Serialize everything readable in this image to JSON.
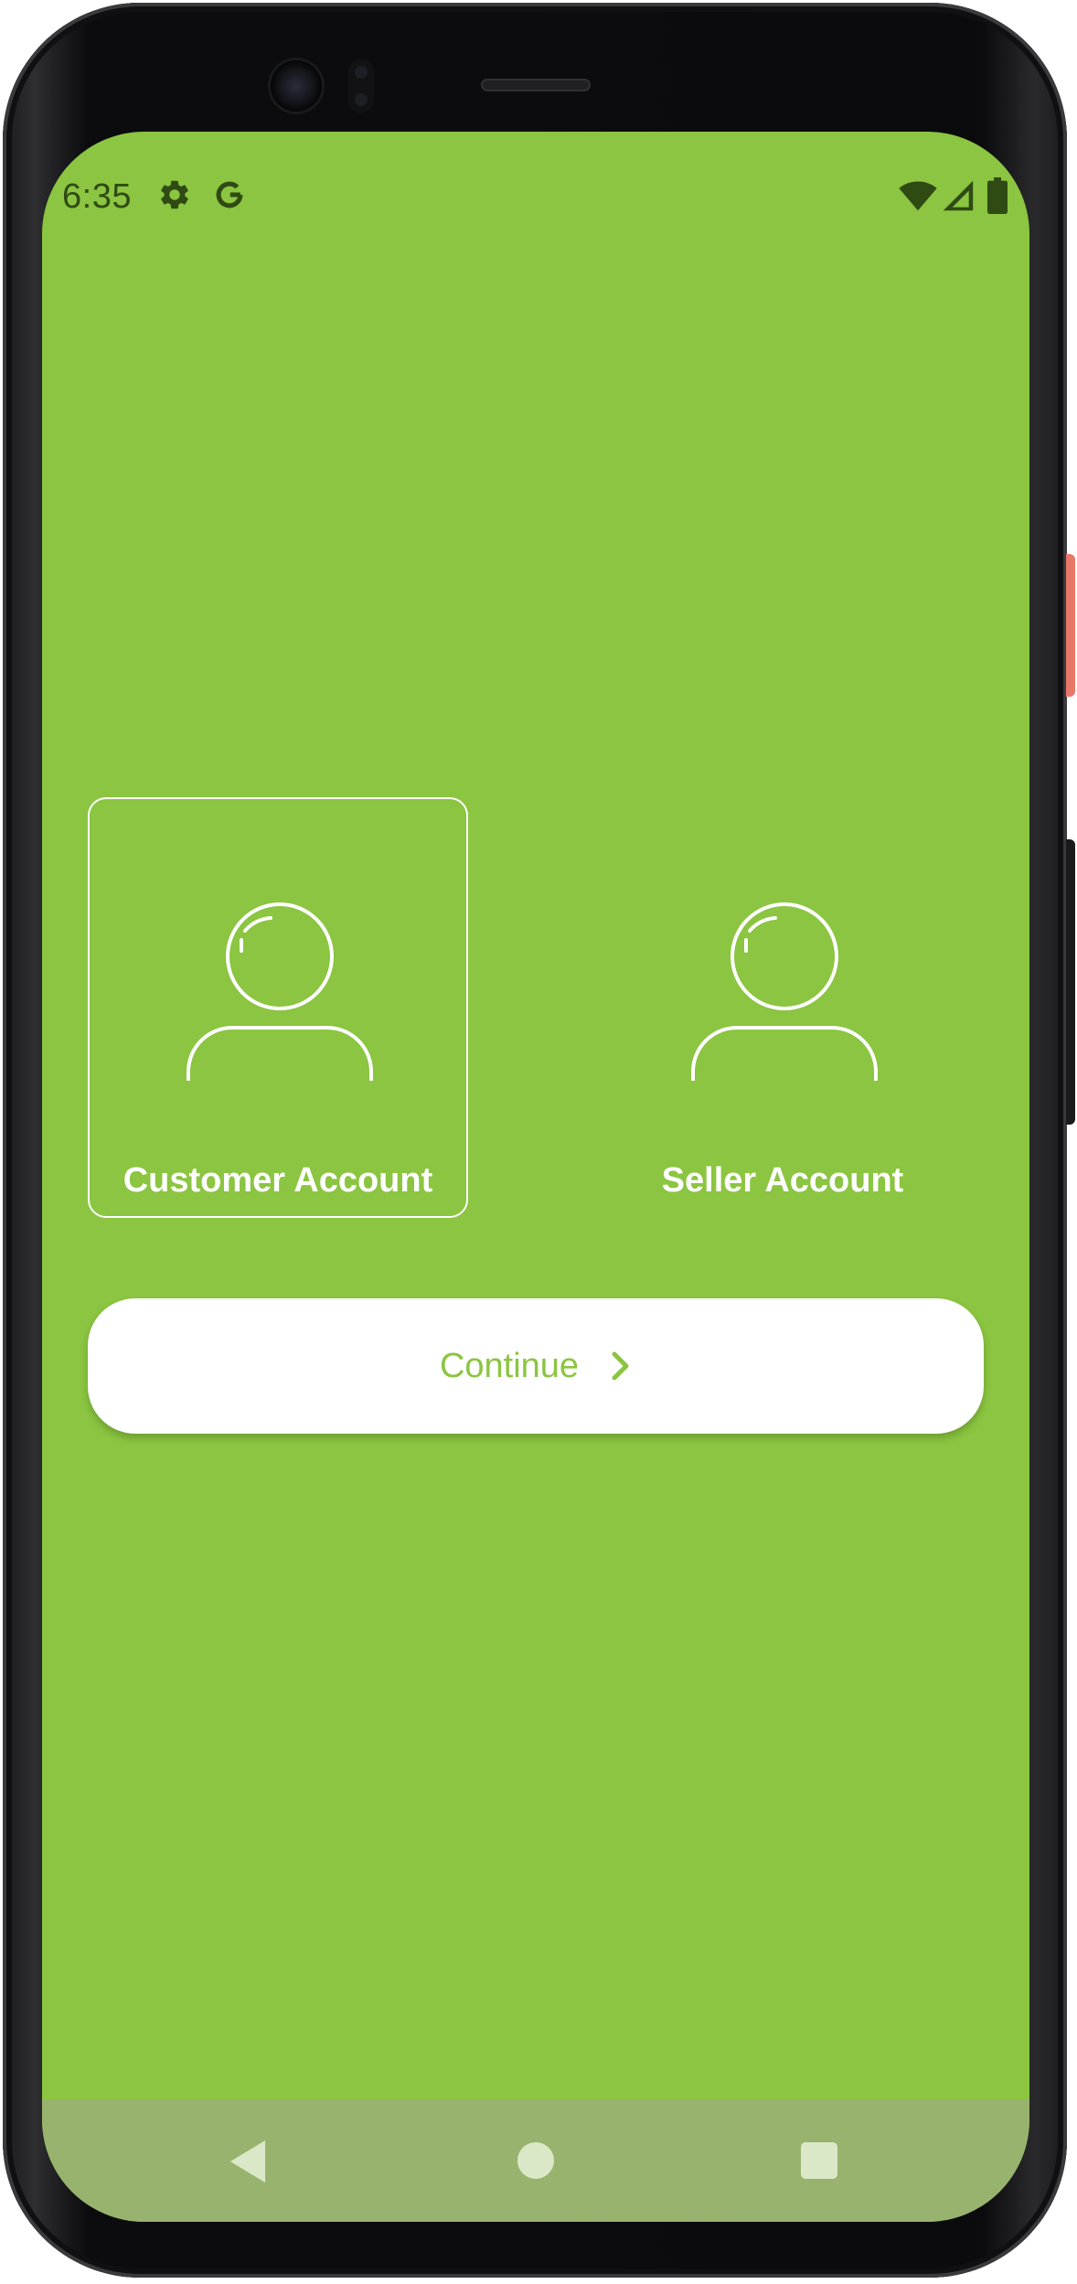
{
  "status_bar": {
    "time": "6:35",
    "left_icons": [
      "gear-icon",
      "google-g-icon"
    ],
    "right_icons": [
      "wifi-icon",
      "cell-signal-icon",
      "battery-icon"
    ]
  },
  "account_options": [
    {
      "label": "Customer Account",
      "icon": "person-outline-icon",
      "selected": true
    },
    {
      "label": "Seller Account",
      "icon": "person-outline-icon",
      "selected": false
    }
  ],
  "continue_button": {
    "label": "Continue",
    "icon": "chevron-right-icon"
  },
  "nav_bar": {
    "items": [
      "back-icon",
      "home-icon",
      "recents-icon"
    ]
  },
  "colors": {
    "background": "#8bc541",
    "accent_text": "#8bc541",
    "card_text": "#ffffff",
    "nav_bar": "#98b36e",
    "status_icons": "#2f4a12"
  }
}
